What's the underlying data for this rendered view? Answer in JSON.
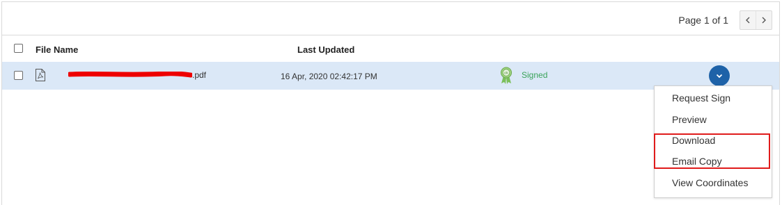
{
  "pagination": {
    "text": "Page 1 of 1",
    "prev_icon": "chevron-left-icon",
    "next_icon": "chevron-right-icon"
  },
  "table": {
    "columns": {
      "file_name": "File Name",
      "last_updated": "Last Updated"
    },
    "rows": [
      {
        "file_type_icon": "pdf-file-icon",
        "file_name_suffix": ".pdf",
        "last_updated": "16 Apr, 2020 02:42:17 PM",
        "status_icon": "award-badge-icon",
        "status": "Signed",
        "status_color": "#3aa35a"
      }
    ]
  },
  "actions_menu": {
    "toggle_icon": "chevron-down-icon",
    "toggle_color": "#1e62a8",
    "items": [
      "Request Sign",
      "Preview",
      "Download",
      "Email Copy",
      "View Coordinates"
    ]
  },
  "colors": {
    "row_highlight": "#dbe8f7",
    "annotation_box": "#e01b1b",
    "redaction": "#ee0000"
  }
}
